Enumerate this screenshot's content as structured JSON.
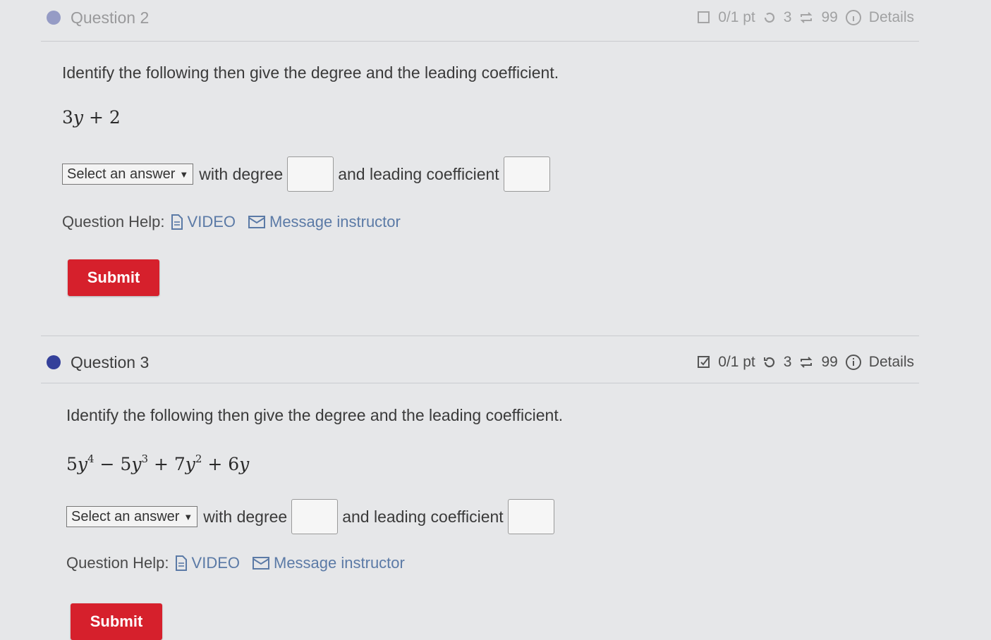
{
  "question2": {
    "title": "Question 2",
    "points": "0/1 pt",
    "tries": "3",
    "retries": "99",
    "details_label": "Details",
    "prompt": "Identify the following then give the degree and the leading coefficient.",
    "expression": "3y + 2",
    "select_label": "Select an answer",
    "with_degree_label": "with degree",
    "leading_coef_label": "and leading coefficient",
    "help_label": "Question Help:",
    "video_label": "VIDEO",
    "message_label": "Message instructor",
    "submit_label": "Submit"
  },
  "question3": {
    "title": "Question 3",
    "points": "0/1 pt",
    "tries": "3",
    "retries": "99",
    "details_label": "Details",
    "prompt": "Identify the following then give the degree and the leading coefficient.",
    "expression": "5y^4 − 5y^3 + 7y^2 + 6y",
    "select_label": "Select an answer",
    "with_degree_label": "with degree",
    "leading_coef_label": "and leading coefficient",
    "help_label": "Question Help:",
    "video_label": "VIDEO",
    "message_label": "Message instructor",
    "submit_label": "Submit"
  },
  "colors": {
    "accent": "#34409a",
    "submit": "#d6202c",
    "link": "#5b7aa6",
    "background": "#e6e7e9"
  },
  "icons": {
    "points": "checkbox-icon",
    "tries": "retry-icon",
    "retries": "repeat-icon",
    "details": "info-icon",
    "video": "document-icon",
    "message": "envelope-icon"
  }
}
